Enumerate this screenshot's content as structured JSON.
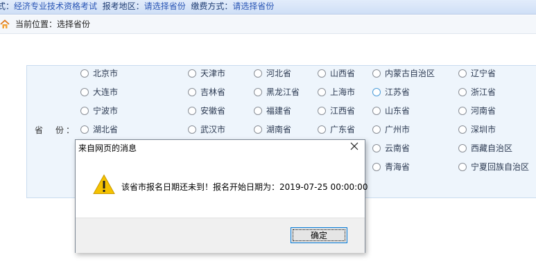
{
  "header": {
    "exam_label": "式：",
    "exam_value": "经济专业技术资格考试",
    "region_label": "报考地区：",
    "region_value": "请选择省份",
    "payment_label": "缴费方式：",
    "payment_value": "请选择省份"
  },
  "breadcrumb": {
    "text": "当前位置：选择省份"
  },
  "province_form": {
    "label": "省　份：",
    "options": [
      "北京市",
      "天津市",
      "河北省",
      "山西省",
      "内蒙古自治区",
      "辽宁省",
      "大连市",
      "吉林省",
      "黑龙江省",
      "上海市",
      "江苏省",
      "浙江省",
      "宁波市",
      "安徽省",
      "福建省",
      "江西省",
      "山东省",
      "河南省",
      "湖北省",
      "武汉市",
      "湖南省",
      "广东省",
      "广州市",
      "深圳市",
      "云南省",
      "西藏自治区",
      "青海省",
      "宁夏回族自治区"
    ]
  },
  "dialog": {
    "title": "来自网页的消息",
    "message": "该省市报名日期还未到！报名开始日期为：2019-07-25 00:00:00",
    "ok_label": "确定"
  },
  "colors": {
    "accent": "#2a56b5",
    "panel": "#eef5fc",
    "warning": "#f5c200"
  }
}
